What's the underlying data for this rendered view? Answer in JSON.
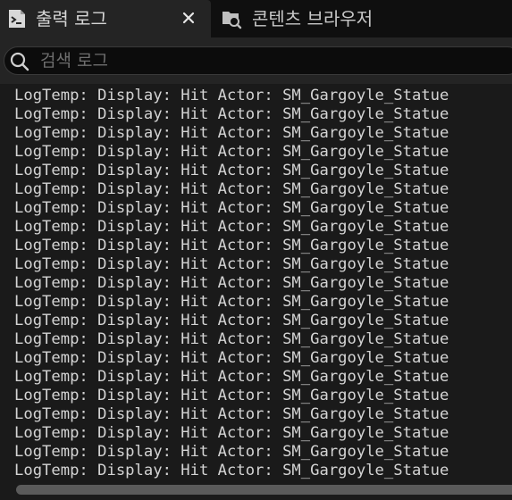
{
  "tabs": [
    {
      "label": "출력 로그",
      "icon": "terminal-icon",
      "active": true,
      "closable": true
    },
    {
      "label": "콘텐츠 브라우저",
      "icon": "content-browser-icon",
      "active": false,
      "closable": false
    }
  ],
  "search": {
    "placeholder": "검색 로그",
    "value": ""
  },
  "log": {
    "lines": [
      "LogTemp: Display: Hit Actor: SM_Gargoyle_Statue",
      "LogTemp: Display: Hit Actor: SM_Gargoyle_Statue",
      "LogTemp: Display: Hit Actor: SM_Gargoyle_Statue",
      "LogTemp: Display: Hit Actor: SM_Gargoyle_Statue",
      "LogTemp: Display: Hit Actor: SM_Gargoyle_Statue",
      "LogTemp: Display: Hit Actor: SM_Gargoyle_Statue",
      "LogTemp: Display: Hit Actor: SM_Gargoyle_Statue",
      "LogTemp: Display: Hit Actor: SM_Gargoyle_Statue",
      "LogTemp: Display: Hit Actor: SM_Gargoyle_Statue",
      "LogTemp: Display: Hit Actor: SM_Gargoyle_Statue",
      "LogTemp: Display: Hit Actor: SM_Gargoyle_Statue",
      "LogTemp: Display: Hit Actor: SM_Gargoyle_Statue",
      "LogTemp: Display: Hit Actor: SM_Gargoyle_Statue",
      "LogTemp: Display: Hit Actor: SM_Gargoyle_Statue",
      "LogTemp: Display: Hit Actor: SM_Gargoyle_Statue",
      "LogTemp: Display: Hit Actor: SM_Gargoyle_Statue",
      "LogTemp: Display: Hit Actor: SM_Gargoyle_Statue",
      "LogTemp: Display: Hit Actor: SM_Gargoyle_Statue",
      "LogTemp: Display: Hit Actor: SM_Gargoyle_Statue",
      "LogTemp: Display: Hit Actor: SM_Gargoyle_Statue",
      "LogTemp: Display: Hit Actor: SM_Gargoyle_Statue"
    ]
  },
  "colors": {
    "background": "#1a1a1a",
    "tabbar": "#0f0f0f",
    "active_tab": "#242424",
    "text": "#d4d4d4",
    "scrollbar_thumb": "#5a5a5a"
  }
}
